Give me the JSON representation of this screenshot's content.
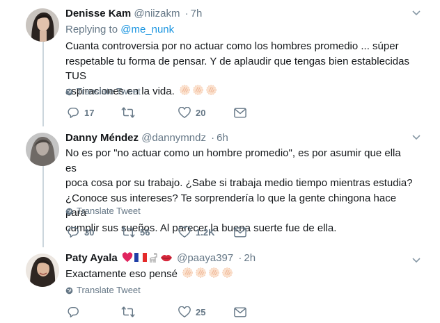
{
  "colors": {
    "accent": "#1b95e0",
    "muted": "#657786",
    "heart": "#e0245e"
  },
  "tweets": [
    {
      "name": "Denisse Kam",
      "handle": "@niizakm",
      "dot": "·",
      "time": "7h",
      "replying_label": "Replying to",
      "replying_to": "@me_nunk",
      "lines": [
        "Cuanta controversia por no actuar como los hombres promedio ... súper",
        "respetable tu forma de pensar. Y de aplaudir que tengas bien establecidas TUS",
        "aspiraciones en la vida."
      ],
      "translate": "Translate Tweet",
      "replies": "17",
      "retweets": "",
      "likes": "20"
    },
    {
      "name": "Danny Méndez",
      "handle": "@dannymndz",
      "dot": "·",
      "time": "6h",
      "lines": [
        "No es por \"no actuar como un hombre promedio\", es por asumir que ella es",
        "poca cosa por su trabajo. ¿Sabe si trabaja medio tiempo mientras estudia?",
        "¿Conoce sus intereses? Te sorprendería lo que la gente chingona hace para",
        "cumplir sus sueños. Al parecer la buena suerte fue de ella."
      ],
      "translate": "Translate Tweet",
      "replies": "30",
      "retweets": "56",
      "likes": "1.2K"
    },
    {
      "name": "Paty Ayala",
      "handle": "@paaya397",
      "dot": "·",
      "time": "2h",
      "lines": [
        "Exactamente eso pensé"
      ],
      "translate": "Translate Tweet",
      "replies": "",
      "retweets": "",
      "likes": "25"
    }
  ]
}
